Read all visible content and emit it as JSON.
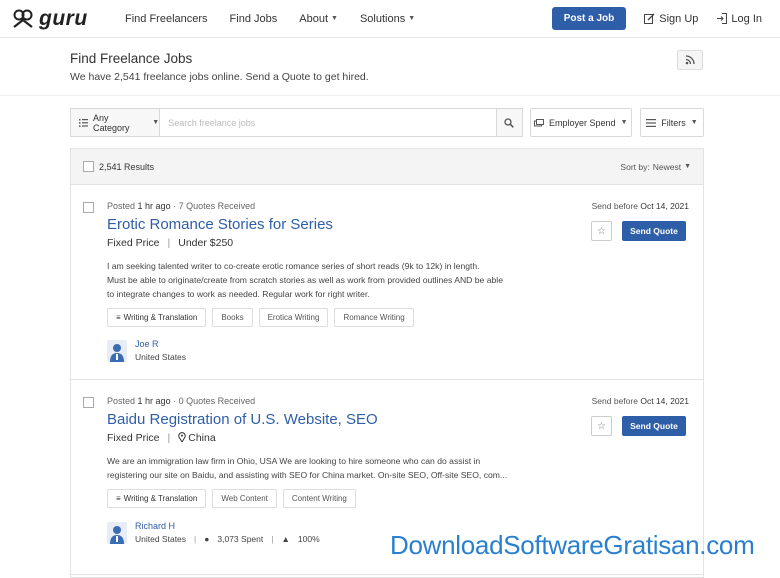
{
  "nav": {
    "logo_text": "guru",
    "links": [
      {
        "label": "Find Freelancers",
        "caret": false
      },
      {
        "label": "Find Jobs",
        "caret": false
      },
      {
        "label": "About",
        "caret": true
      },
      {
        "label": "Solutions",
        "caret": true
      }
    ],
    "post_job": "Post a Job",
    "sign_up": "Sign Up",
    "log_in": "Log In"
  },
  "header": {
    "title": "Find Freelance Jobs",
    "subtitle": "We have 2,541 freelance jobs online. Send a Quote to get hired.",
    "rss_icon": "rss-icon"
  },
  "search": {
    "category": "Any Category",
    "placeholder": "Search freelance jobs",
    "employer_spend": "Employer Spend",
    "filters": "Filters"
  },
  "results": {
    "count": "2,541 Results",
    "sort_label": "Sort by:",
    "sort_value": "Newest"
  },
  "jobs": [
    {
      "posted_prefix": "Posted",
      "posted_time": "1 hr ago",
      "quotes": "· 7 Quotes Received",
      "title": "Erotic Romance Stories for Series",
      "price_type": "Fixed Price",
      "price_sep": "|",
      "price_detail": "Under $250",
      "desc": [
        "I am seeking talented writer to co-create erotic romance series of short reads (9k to 12k) in length.",
        "Must be able to originate/create from scratch stories as well as work from provided outlines AND be able",
        "to integrate changes to work as needed.  Regular work for right writer."
      ],
      "category_tag": "Writing & Translation",
      "tags": [
        "Books",
        "Erotica Writing",
        "Romance Writing"
      ],
      "poster_name": "Joe R",
      "poster_location": "United States",
      "send_before_label": "Send before",
      "send_before_date": "Oct 14, 2021",
      "send_quote": "Send Quote"
    },
    {
      "posted_prefix": "Posted",
      "posted_time": "1 hr ago",
      "quotes": "· 0 Quotes Received",
      "title": "Baidu Registration of U.S. Website, SEO",
      "price_type": "Fixed Price",
      "price_sep": "|",
      "price_detail": "China",
      "desc": [
        "We are an immigration law firm in Ohio, USA  We are looking to hire someone who can do assist in",
        "registering our site on Baidu, and assisting with SEO for China market.  On-site SEO, Off-site SEO, com..."
      ],
      "category_tag": "Writing & Translation",
      "tags": [
        "Web Content",
        "Content Writing"
      ],
      "poster_name": "Richard H",
      "poster_location": "United States",
      "poster_spent": "3,073 Spent",
      "poster_rating": "100%",
      "send_before_label": "Send before",
      "send_before_date": "Oct 14, 2021",
      "send_quote": "Send Quote"
    }
  ],
  "watermark": "DownloadSoftwareGratisan.com"
}
